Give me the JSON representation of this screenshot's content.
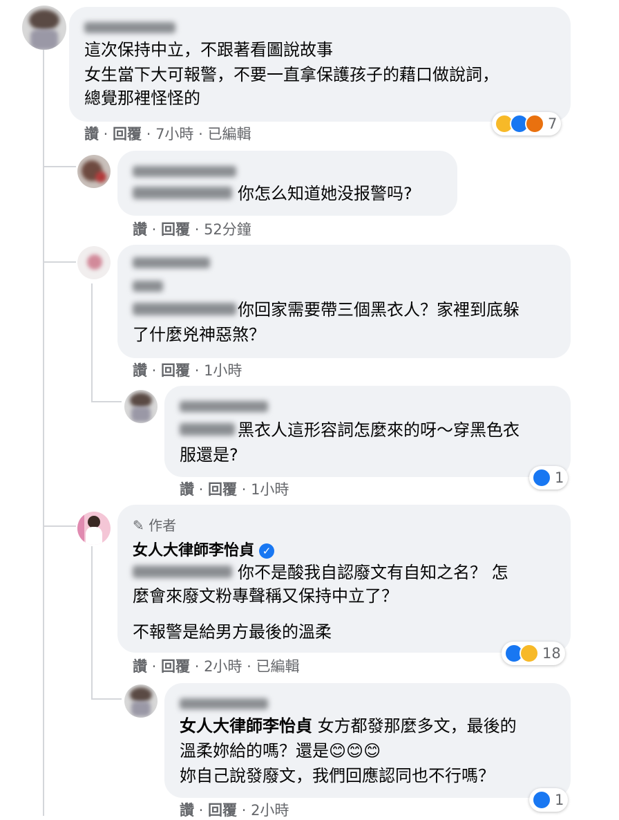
{
  "comments": [
    {
      "text_lines": [
        "這次保持中立，不跟著看圖說故事",
        "女生當下大可報警，不要一直拿保護孩子的藉口做說詞，",
        "總覺那裡怪怪的"
      ],
      "actions": {
        "like": "讚",
        "reply": "回覆",
        "meta": "7小時 · 已編輯"
      },
      "reactions": {
        "icons": [
          "haha-icon",
          "like-icon",
          "angry-icon"
        ],
        "count": "7"
      }
    },
    {
      "text_lines": [
        "你怎么知道她没报警吗?"
      ],
      "actions": {
        "like": "讚",
        "reply": "回覆",
        "meta": "52分鐘"
      }
    },
    {
      "text_lines": [
        "你回家需要帶三個黑衣人？家裡到底躲",
        "了什麼兇神惡煞？"
      ],
      "actions": {
        "like": "讚",
        "reply": "回覆",
        "meta": "1小時"
      }
    },
    {
      "text_lines": [
        "黑衣人這形容詞怎麼來的呀～穿黑色衣",
        "服還是?"
      ],
      "actions": {
        "like": "讚",
        "reply": "回覆",
        "meta": "1小時"
      },
      "reactions": {
        "icons": [
          "like-icon"
        ],
        "count": "1"
      }
    },
    {
      "badge": "作者",
      "author": "女人大律師李怡貞",
      "text_lines": [
        "你不是酸我自認廢文有自知之名？ 怎",
        "麼會來廢文粉專聲稱又保持中立了？",
        "不報警是給男方最後的溫柔"
      ],
      "actions": {
        "like": "讚",
        "reply": "回覆",
        "meta": "2小時 · 已編輯"
      },
      "reactions": {
        "icons": [
          "like-icon",
          "haha-icon"
        ],
        "count": "18"
      }
    },
    {
      "mention": "女人大律師李怡貞",
      "text_lines": [
        "女方都發那麼多文，最後的",
        "溫柔妳給的嗎？還是",
        "妳自己說發廢文，我們回應認同也不行嗎？"
      ],
      "emoji": [
        "😊",
        "😊",
        "😊"
      ],
      "actions": {
        "like": "讚",
        "reply": "回覆",
        "meta": "2小時"
      },
      "reactions": {
        "icons": [
          "like-icon"
        ],
        "count": "1"
      }
    }
  ],
  "sep": " · ",
  "colors": {
    "bubble": "#f0f2f5",
    "meta": "#65676b",
    "like": "#1877f2",
    "haha": "#f7b928",
    "angry": "#e9710f",
    "verified": "#1877f2"
  }
}
